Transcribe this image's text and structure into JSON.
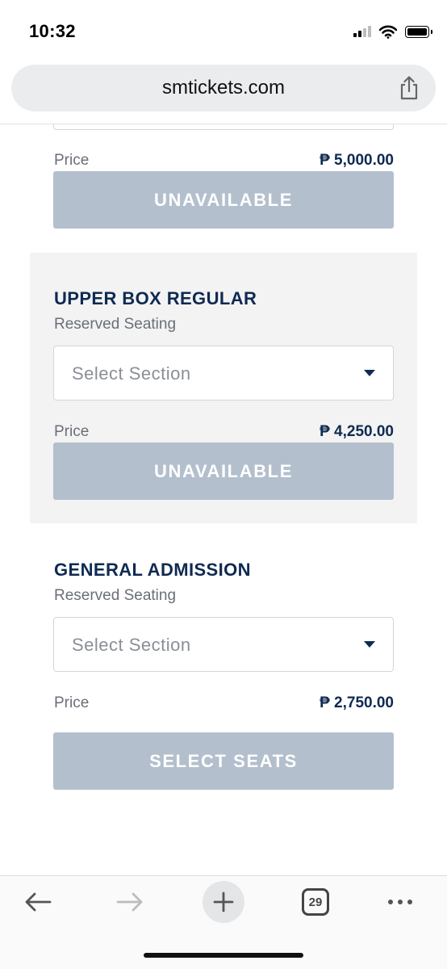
{
  "status_bar": {
    "time": "10:32"
  },
  "browser": {
    "url": "smtickets.com",
    "tab_count": "29"
  },
  "tickets": [
    {
      "title": "",
      "subtitle": "",
      "select_placeholder": "",
      "price_label": "Price",
      "price": "₱ 5,000.00",
      "button_label": "UNAVAILABLE"
    },
    {
      "title": "UPPER BOX REGULAR",
      "subtitle": "Reserved Seating",
      "select_placeholder": "Select Section",
      "price_label": "Price",
      "price": "₱ 4,250.00",
      "button_label": "UNAVAILABLE"
    },
    {
      "title": "GENERAL ADMISSION",
      "subtitle": "Reserved Seating",
      "select_placeholder": "Select Section",
      "price_label": "Price",
      "price": "₱ 2,750.00",
      "button_label": "SELECT SEATS"
    }
  ],
  "colors": {
    "brand_navy": "#0f2a52",
    "button_disabled": "#b3bfcd",
    "card_shade": "#f3f3f3"
  },
  "icons": {
    "share": "share-icon",
    "back": "arrow-left-icon",
    "forward": "arrow-right-icon",
    "new_tab": "plus-icon",
    "tabs": "tabs-icon",
    "more": "more-icon"
  }
}
